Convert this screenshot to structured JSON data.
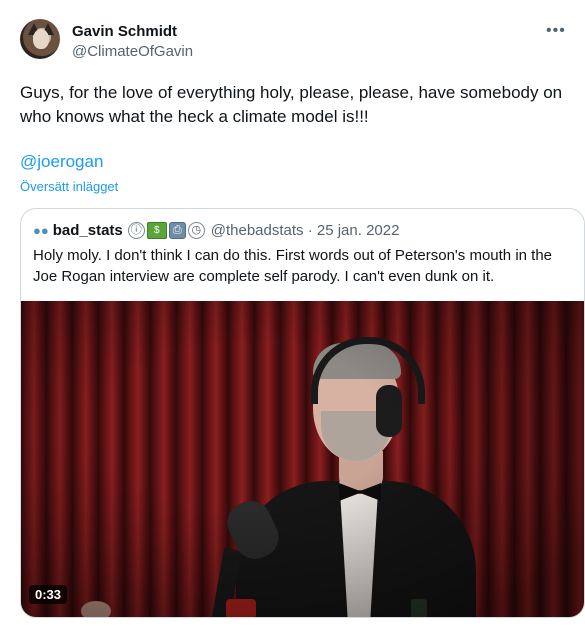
{
  "author": {
    "name": "Gavin Schmidt",
    "handle": "@ClimateOfGavin",
    "more_icon": "more-horizontal-icon"
  },
  "tweet": {
    "text": "Guys, for the love of everything holy, please, please, have somebody on who knows what the heck a climate model is!!!",
    "mention": "@joerogan",
    "translate_label": "Översätt inlägget"
  },
  "quoted": {
    "name": "bad_stats",
    "badges": [
      "ⓘ",
      "$",
      "⎙",
      "◷"
    ],
    "meta": "@thebadstats · 25 jan. 2022",
    "text": "Holy moly. I don't think I can do this. First words out of Peterson's mouth in the Joe Rogan interview are complete self parody. I can't even dunk on it.",
    "video_time": "0:33"
  }
}
